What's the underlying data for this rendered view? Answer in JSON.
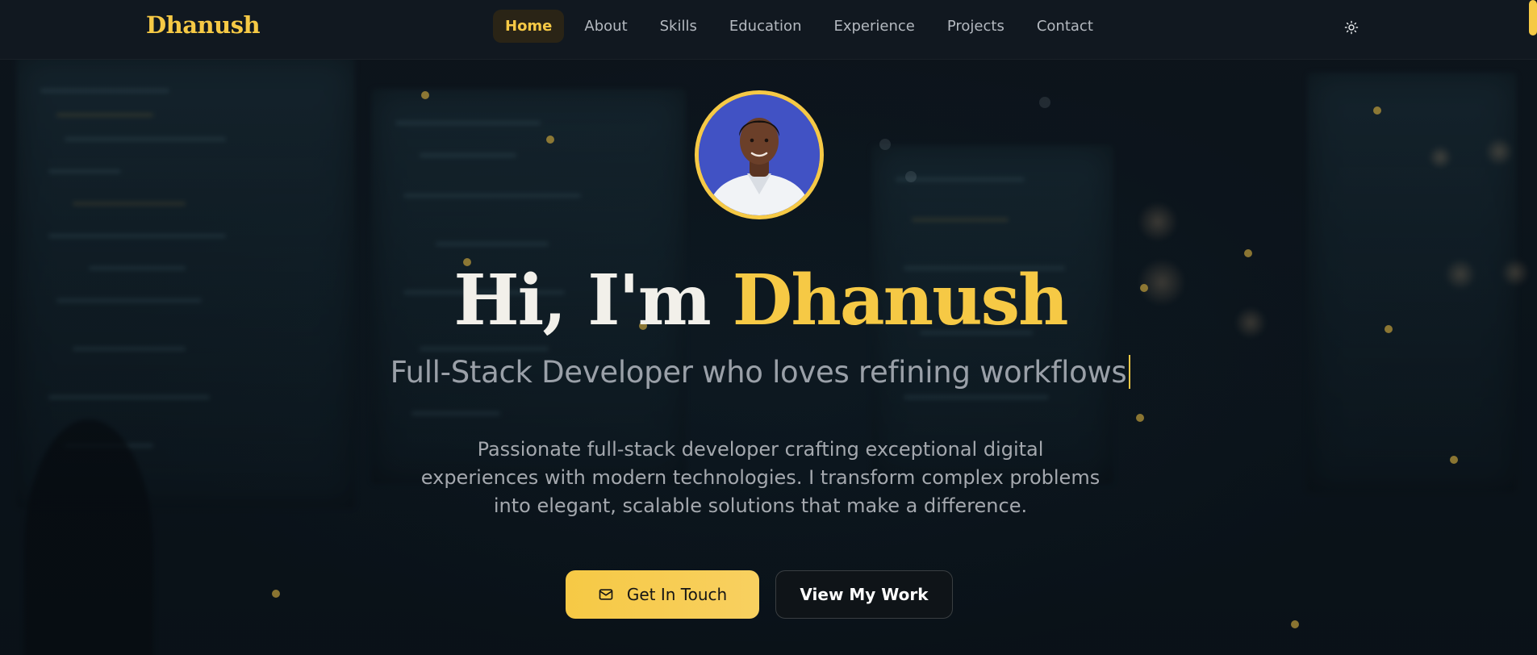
{
  "nav": {
    "brand": "Dhanush",
    "links": [
      {
        "label": "Home",
        "active": true
      },
      {
        "label": "About"
      },
      {
        "label": "Skills"
      },
      {
        "label": "Education"
      },
      {
        "label": "Experience"
      },
      {
        "label": "Projects"
      },
      {
        "label": "Contact"
      }
    ],
    "theme_toggle_icon": "sun-icon"
  },
  "hero": {
    "greeting": "Hi, I'm",
    "name": "Dhanush",
    "subtitle": "Full-Stack Developer who loves refining workflows",
    "description": "Passionate full-stack developer crafting exceptional digital experiences with modern technologies. I transform complex problems into elegant, scalable solutions that make a difference.",
    "primary_button": {
      "label": "Get In Touch",
      "icon": "mail-icon"
    },
    "secondary_button": {
      "label": "View My Work"
    }
  },
  "colors": {
    "accent": "#f6c945",
    "background": "#0b1118",
    "nav_background": "#111820",
    "text_muted": "#9aa0a8",
    "avatar_background": "#4152c4"
  }
}
